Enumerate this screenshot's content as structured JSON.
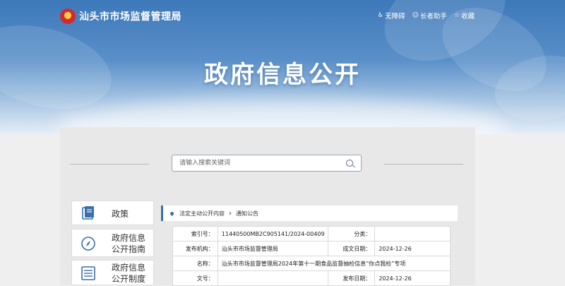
{
  "header": {
    "site_name": "汕头市市场监督管理局",
    "links": [
      {
        "icon": "accessibility-icon",
        "label": "无障碍"
      },
      {
        "icon": "elder-assist-icon",
        "label": "长者助手"
      },
      {
        "icon": "bookmark-icon",
        "label": "收藏"
      }
    ],
    "hero_title": "政府信息公开"
  },
  "search": {
    "placeholder": "请输入搜索关键词"
  },
  "sidebar": {
    "items": [
      {
        "label": "政策",
        "icon": "policy-book-icon"
      },
      {
        "label": "政府信息公开指南",
        "icon": "compass-icon"
      },
      {
        "label": "政府信息公开制度",
        "icon": "list-doc-icon"
      }
    ]
  },
  "breadcrumb": {
    "items": [
      "法定主动公开内容",
      "通知公告"
    ],
    "separator": "›"
  },
  "info_table": {
    "index_label": "索引号：",
    "index_value": "11440500MB2C905141/2024-00409",
    "category_label": "分类：",
    "category_value": "",
    "publisher_label": "发布机构：",
    "publisher_value": "汕头市市场监督管理局",
    "created_label": "成文日期：",
    "created_value": "2024-12-26",
    "title_label": "名称：",
    "title_value": "汕头市市场监督管理局2024年第十一期食品监督抽检信息“你点我检”专项",
    "docno_label": "文号：",
    "docno_value": "",
    "published_label": "发布日期：",
    "published_value": "2024-12-26"
  },
  "colors": {
    "accent": "#3a6fa8",
    "hero_top": "#3d78b9",
    "page_bg": "#efefef"
  }
}
